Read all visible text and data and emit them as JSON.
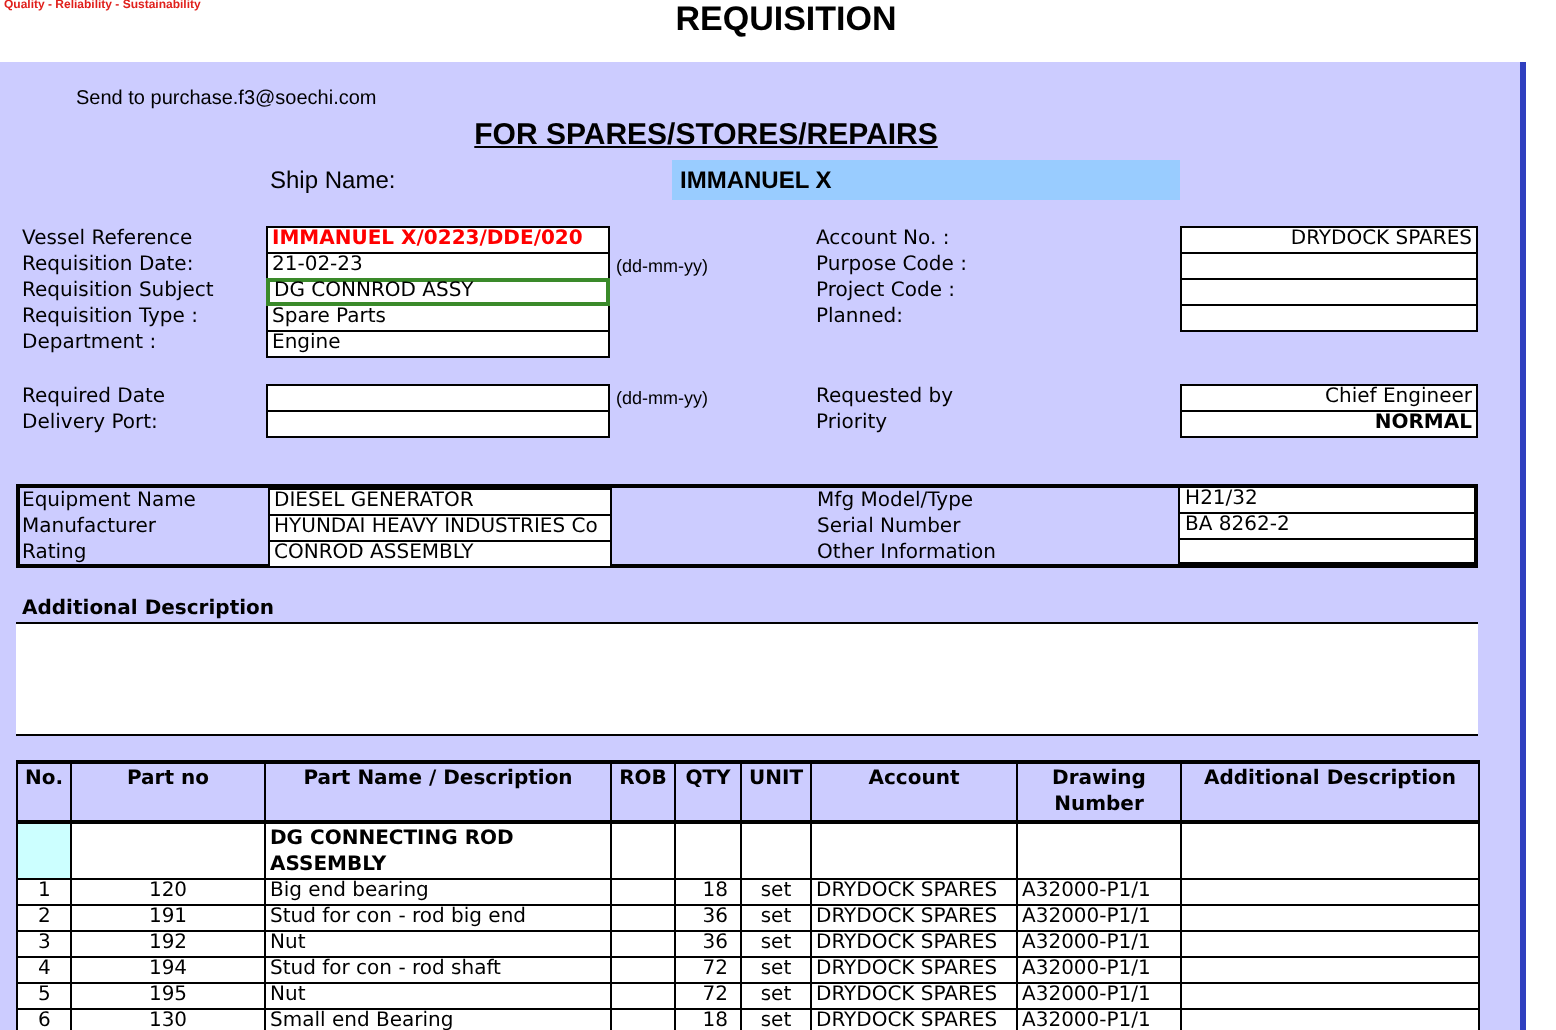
{
  "header": {
    "tagline": "Quality - Reliability - Sustainability",
    "title": "REQUISITION"
  },
  "send_to": "Send to purchase.f3@soechi.com",
  "heading": "FOR SPARES/STORES/REPAIRS",
  "ship_name": {
    "label": "Ship Name:",
    "value": "IMMANUEL X"
  },
  "details_left": [
    {
      "label": "Vessel Reference",
      "value": "IMMANUEL X/0223/DDE/020",
      "kind": "alert",
      "selected": false
    },
    {
      "label": "Requisition Date:",
      "value": "21-02-23",
      "note": "(dd-mm-yy)",
      "kind": "plain",
      "selected": false
    },
    {
      "label": "Requisition Subject",
      "value": "DG CONNROD ASSY",
      "kind": "plain",
      "selected": true
    },
    {
      "label": "Requisition Type :",
      "value": "Spare Parts",
      "kind": "plain",
      "selected": false
    },
    {
      "label": "Department :",
      "value": "Engine",
      "kind": "plain",
      "selected": false
    }
  ],
  "details_right": [
    {
      "label": "Account No. :",
      "value": "DRYDOCK SPARES"
    },
    {
      "label": "Purpose Code :"
    },
    {
      "label": "Project Code :"
    },
    {
      "label": "Planned:"
    }
  ],
  "delivery_left": [
    {
      "label": "Required Date",
      "note": "(dd-mm-yy)"
    },
    {
      "label": "Delivery Port:"
    }
  ],
  "delivery_right": [
    {
      "label": "Requested by",
      "value": "Chief Engineer",
      "kind": "plain"
    },
    {
      "label": "Priority",
      "value": "NORMAL",
      "kind": "bold"
    }
  ],
  "equipment": {
    "left": [
      {
        "label": "Equipment Name",
        "value": "DIESEL GENERATOR"
      },
      {
        "label": "Manufacturer",
        "value": "HYUNDAI HEAVY INDUSTRIES Co"
      },
      {
        "label": "Rating",
        "value": "CONROD ASSEMBLY"
      }
    ],
    "right": [
      {
        "label": "Mfg Model/Type",
        "value": "H21/32"
      },
      {
        "label": "Serial Number",
        "value": "BA 8262-2"
      },
      {
        "label": "Other Information"
      }
    ]
  },
  "additional_description": {
    "label": "Additional Description"
  },
  "parts_table": {
    "columns": [
      "No.",
      "Part no",
      "Part Name / Description",
      "ROB",
      "QTY",
      "UNIT",
      "Account",
      "Drawing Number",
      "Additional Description"
    ],
    "rows": [
      {
        "kind": "group",
        "description": "DG  CONNECTING ROD ASSEMBLY"
      },
      {
        "kind": "item",
        "no": "1",
        "part_no": "120",
        "description": "Big end bearing",
        "qty": "18",
        "unit": "set",
        "account": "DRYDOCK SPARES",
        "drawing": "A32000-P1/1"
      },
      {
        "kind": "item",
        "no": "2",
        "part_no": "191",
        "description": "Stud for con - rod big end",
        "qty": "36",
        "unit": "set",
        "account": "DRYDOCK SPARES",
        "drawing": "A32000-P1/1"
      },
      {
        "kind": "item",
        "no": "3",
        "part_no": "192",
        "description": "Nut",
        "qty": "36",
        "unit": "set",
        "account": "DRYDOCK SPARES",
        "drawing": "A32000-P1/1"
      },
      {
        "kind": "item",
        "no": "4",
        "part_no": "194",
        "description": "Stud for con - rod shaft",
        "qty": "72",
        "unit": "set",
        "account": "DRYDOCK SPARES",
        "drawing": "A32000-P1/1"
      },
      {
        "kind": "item",
        "no": "5",
        "part_no": "195",
        "description": "Nut",
        "qty": "72",
        "unit": "set",
        "account": "DRYDOCK SPARES",
        "drawing": "A32000-P1/1"
      },
      {
        "kind": "item",
        "no": "6",
        "part_no": "130",
        "description": "Small end Bearing",
        "qty": "18",
        "unit": "set",
        "account": "DRYDOCK SPARES",
        "drawing": "A32000-P1/1"
      }
    ]
  }
}
